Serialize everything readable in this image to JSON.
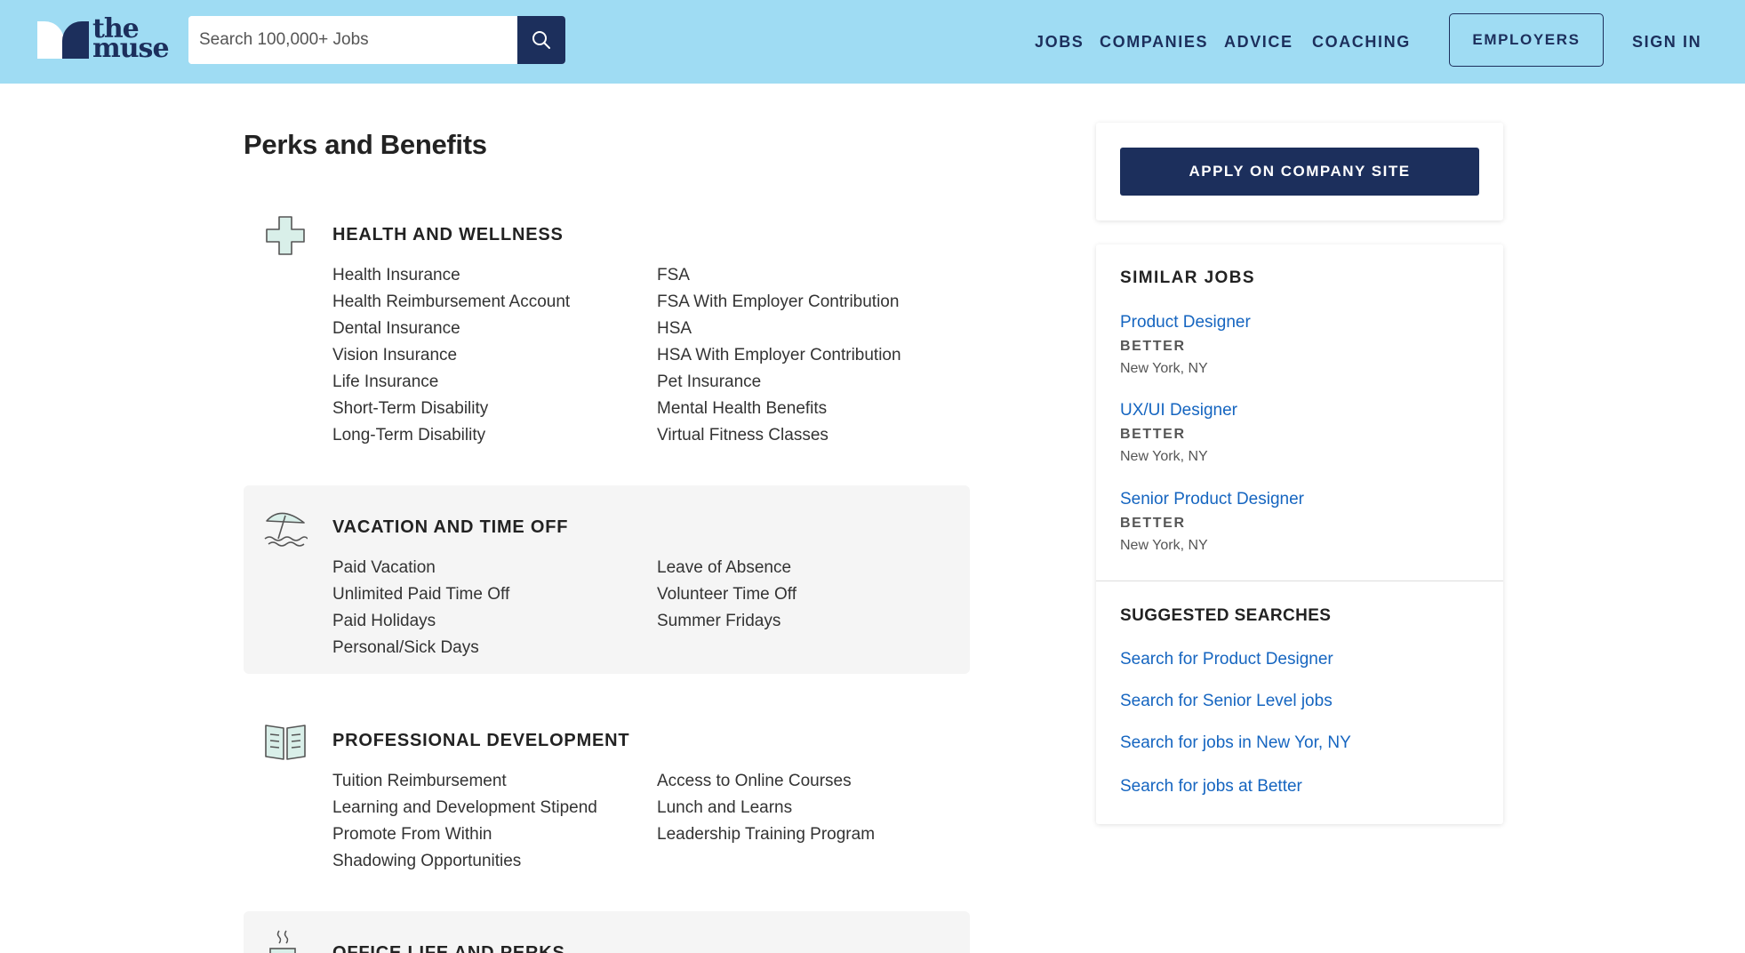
{
  "header": {
    "logo_line1": "the",
    "logo_line2": "muse",
    "search_placeholder": "Search 100,000+ Jobs",
    "nav": [
      "JOBS",
      "COMPANIES",
      "ADVICE",
      "COACHING"
    ],
    "employers_label": "EMPLOYERS",
    "signin_label": "SIGN IN",
    "colors": {
      "bar": "#9fdcf3",
      "navy": "#1c2f5c"
    }
  },
  "main": {
    "title": "Perks and Benefits",
    "sections": [
      {
        "icon": "health-cross-icon",
        "heading": "HEALTH AND WELLNESS",
        "col1": [
          "Health Insurance",
          "Health Reimbursement Account",
          "Dental Insurance",
          "Vision Insurance",
          "Life Insurance",
          "Short-Term Disability",
          "Long-Term Disability"
        ],
        "col2": [
          "FSA",
          "FSA With Employer Contribution",
          "HSA",
          "HSA With Employer Contribution",
          "Pet Insurance",
          "Mental Health Benefits",
          "Virtual Fitness Classes"
        ]
      },
      {
        "icon": "beach-umbrella-icon",
        "heading": "VACATION AND TIME OFF",
        "col1": [
          "Paid Vacation",
          "Unlimited Paid Time Off",
          "Paid Holidays",
          "Personal/Sick Days"
        ],
        "col2": [
          "Leave of Absence",
          "Volunteer Time Off",
          "Summer Fridays"
        ]
      },
      {
        "icon": "open-book-icon",
        "heading": "PROFESSIONAL DEVELOPMENT",
        "col1": [
          "Tuition Reimbursement",
          "Learning and Development Stipend",
          "Promote From Within",
          "Shadowing Opportunities"
        ],
        "col2": [
          "Access to Online Courses",
          "Lunch and Learns",
          "Leadership Training Program"
        ]
      },
      {
        "icon": "coffee-cup-icon",
        "heading": "OFFICE LIFE AND PERKS"
      }
    ]
  },
  "sidebar": {
    "apply_label": "APPLY ON COMPANY SITE",
    "similar_heading": "SIMILAR JOBS",
    "jobs": [
      {
        "title": "Product Designer",
        "company": "BETTER",
        "location": "New York, NY"
      },
      {
        "title": "UX/UI Designer",
        "company": "BETTER",
        "location": "New York, NY"
      },
      {
        "title": "Senior Product Designer",
        "company": "BETTER",
        "location": "New York, NY"
      }
    ],
    "suggested_heading": "SUGGESTED SEARCHES",
    "suggestions": [
      "Search for Product Designer",
      "Search for Senior Level jobs",
      "Search for jobs in New Yor, NY",
      "Search for jobs at Better"
    ]
  }
}
